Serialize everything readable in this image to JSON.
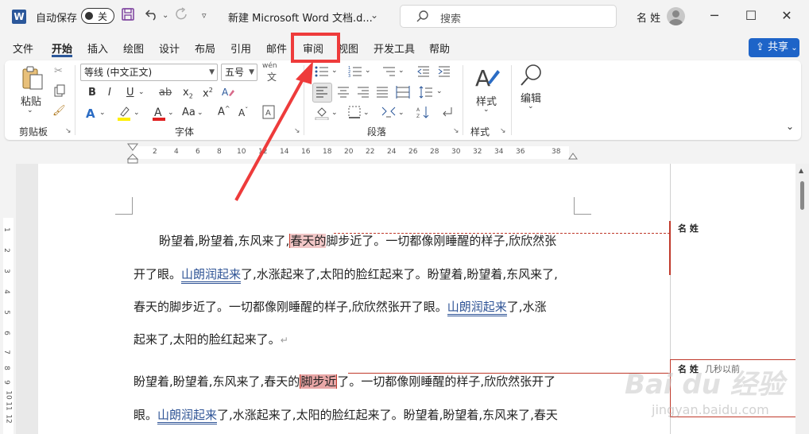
{
  "titlebar": {
    "app_icon": "W",
    "autosave_label": "自动保存",
    "autosave_state": "关",
    "doc_title": "新建 Microsoft Word 文档.d...",
    "search_placeholder": "搜索",
    "user_name": "名 姓",
    "icons": {
      "save": "save-icon",
      "undo": "undo-icon",
      "redo": "redo-icon",
      "customize": "customize-icon",
      "minimize": "minimize-icon",
      "maximize": "maximize-icon",
      "close": "close-icon"
    }
  },
  "tabs": [
    {
      "label": "文件",
      "active": false
    },
    {
      "label": "开始",
      "active": true
    },
    {
      "label": "插入",
      "active": false
    },
    {
      "label": "绘图",
      "active": false
    },
    {
      "label": "设计",
      "active": false
    },
    {
      "label": "布局",
      "active": false
    },
    {
      "label": "引用",
      "active": false
    },
    {
      "label": "邮件",
      "active": false
    },
    {
      "label": "审阅",
      "active": false
    },
    {
      "label": "视图",
      "active": false
    },
    {
      "label": "开发工具",
      "active": false
    },
    {
      "label": "帮助",
      "active": false
    }
  ],
  "share_label": "共享",
  "ribbon": {
    "clipboard": {
      "paste_label": "粘贴",
      "group_label": "剪贴板"
    },
    "font": {
      "font_name": "等线 (中文正文)",
      "font_size": "五号",
      "group_label": "字体",
      "wen_glyph": "wén",
      "a_glyph": "A"
    },
    "paragraph": {
      "group_label": "段落"
    },
    "styles": {
      "label": "样式",
      "group_label": "样式"
    },
    "editing": {
      "label": "编辑"
    }
  },
  "ruler": {
    "ticks": [
      "2",
      "4",
      "6",
      "8",
      "10",
      "12",
      "14",
      "16",
      "18",
      "20",
      "22",
      "24",
      "26",
      "28",
      "30",
      "32",
      "34",
      "36",
      "38"
    ],
    "vticks": [
      "1",
      "2",
      "3",
      "4",
      "5",
      "6",
      "7",
      "8",
      "9",
      "10",
      "11",
      "12"
    ]
  },
  "document": {
    "p1": {
      "l1_a": "盼望着,盼望着,东风来了,",
      "l1_b": "春天的",
      "l1_c": "脚步近了。一切都像刚睡醒的样子,欣欣然张",
      "l2_a": "开了眼。",
      "l2_b": "山朗润起来",
      "l2_c": "了,水涨起来了,太阳的脸红起来了。盼望着,盼望着,东风来了,",
      "l3_a": "春天的脚步近了。一切都像刚睡醒的样子,欣欣然张开了眼。",
      "l3_b": "山朗润起来",
      "l3_c": "了,水涨",
      "l4": "起来了,太阳的脸红起来了。"
    },
    "p2": {
      "l1_a": "盼望着,盼望着,东风来了,春天的",
      "l1_b": "脚步近",
      "l1_c": "了。一切都像刚睡醒的样子,欣欣然张开了",
      "l2_a": "眼。",
      "l2_b": "山朗润起来",
      "l2_c": "了,水涨起来了,太阳的脸红起来了。盼望着,盼望着,东风来了,春天"
    },
    "return_mark": "↵"
  },
  "markup": {
    "c1_name": "名 姓",
    "c2_name": "名 姓",
    "c2_time": "几秒以前"
  },
  "watermark": {
    "main": "Bai du 经验",
    "sub": "jingyan.baidu.com"
  },
  "colors": {
    "accent": "#2b579a",
    "share": "#1e64c8",
    "callout": "#ee3b3b",
    "insert": "#2f5496",
    "revision": "#c0392b"
  }
}
